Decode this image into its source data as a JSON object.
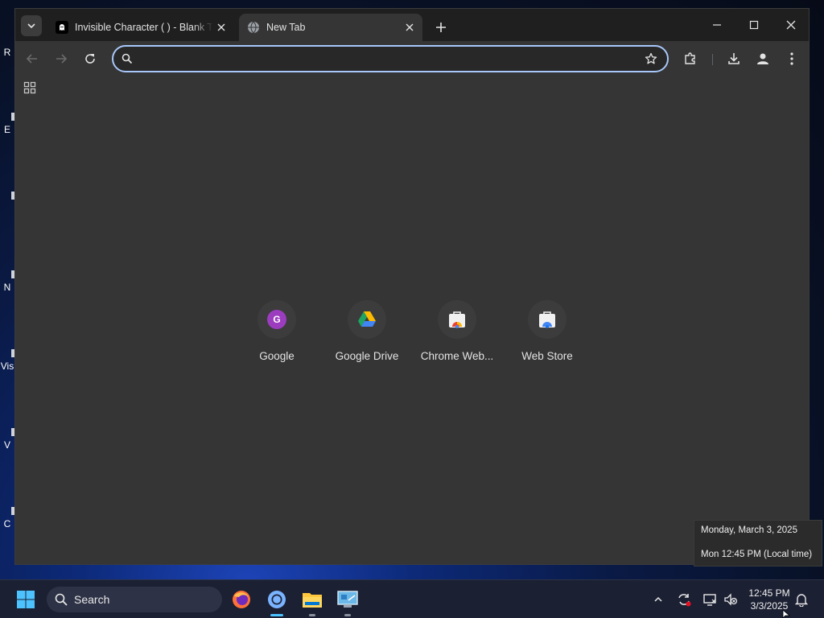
{
  "desktop": {
    "icons": [
      {
        "label": "R"
      },
      {
        "label": "E"
      },
      {
        "label": ""
      },
      {
        "label": "N"
      },
      {
        "label": "Vis"
      },
      {
        "label": "V"
      },
      {
        "label": "C"
      }
    ]
  },
  "browser": {
    "tabs": [
      {
        "title": "Invisible Character (    ) - Blank Text",
        "favicon": "ghost-icon",
        "active": false
      },
      {
        "title": "New Tab",
        "favicon": "globe-icon",
        "active": true
      }
    ],
    "omnibox": {
      "value": "",
      "placeholder": ""
    },
    "toolbar_icons": [
      "back-icon",
      "forward-icon",
      "reload-icon",
      "star-icon",
      "extensions-icon",
      "downloads-icon",
      "profile-icon",
      "menu-icon"
    ]
  },
  "shortcuts": [
    {
      "label": "Google",
      "icon": "google-g-icon",
      "color": "#9c3dbf"
    },
    {
      "label": "Google Drive",
      "icon": "google-drive-icon",
      "color": "#1fa463"
    },
    {
      "label": "Chrome Web...",
      "icon": "chrome-web-store-icon",
      "color": "#ea4335"
    },
    {
      "label": "Web Store",
      "icon": "web-store-icon",
      "color": "#4285f4"
    }
  ],
  "clock_tooltip": {
    "line1": "Monday, March 3, 2025",
    "line2": "Mon 12:45 PM (Local time)"
  },
  "taskbar": {
    "search_label": "Search",
    "time": "12:45 PM",
    "date": "3/3/2025",
    "apps": [
      "firefox-icon",
      "chrome-icon",
      "file-explorer-icon",
      "control-panel-icon"
    ]
  },
  "colors": {
    "accent": "#a8c7fa",
    "window_bg": "#353535",
    "titlebar_bg": "#1f1f1f",
    "taskbar_bg": "#1c2033"
  }
}
